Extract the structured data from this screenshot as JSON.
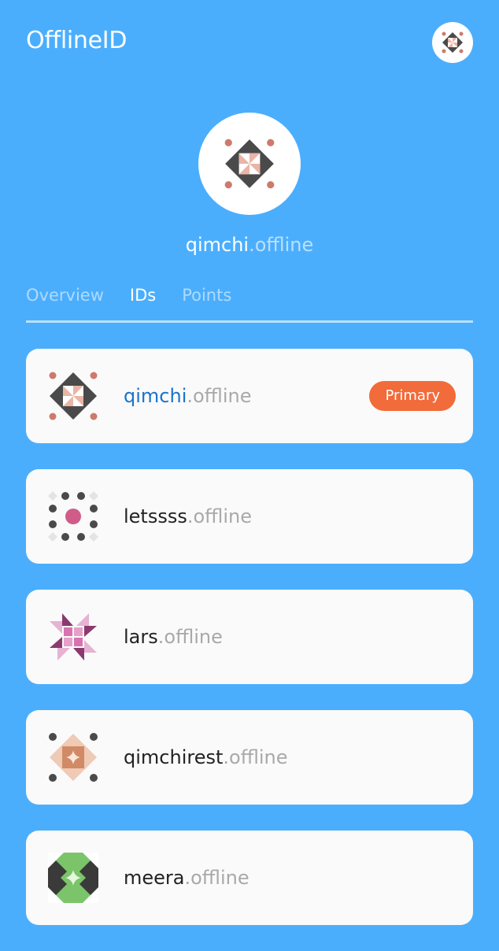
{
  "header": {
    "app_title": "OfflineID",
    "avatar_icon": "quilt-diamond-avatar-icon"
  },
  "profile": {
    "handle": "qimchi",
    "suffix": ".offline",
    "avatar_icon": "quilt-diamond-avatar-icon"
  },
  "tabs": [
    {
      "label": "Overview",
      "active": false
    },
    {
      "label": "IDs",
      "active": true
    },
    {
      "label": "Points",
      "active": false
    }
  ],
  "ids": [
    {
      "handle": "qimchi",
      "suffix": ".offline",
      "badge": "Primary",
      "icon": "quilt-diamond-pink-icon"
    },
    {
      "handle": "letssss",
      "suffix": ".offline",
      "icon": "dot-ring-pink-icon"
    },
    {
      "handle": "lars",
      "suffix": ".offline",
      "icon": "pinwheel-purple-icon"
    },
    {
      "handle": "qimchirest",
      "suffix": ".offline",
      "icon": "sparkle-diamond-tan-icon"
    },
    {
      "handle": "meera",
      "suffix": ".offline",
      "icon": "star-green-icon"
    }
  ],
  "colors": {
    "background": "#4BAEFD",
    "primary_badge": "#F26B3A",
    "primary_handle": "#1a73c9",
    "card": "#fafafa"
  }
}
